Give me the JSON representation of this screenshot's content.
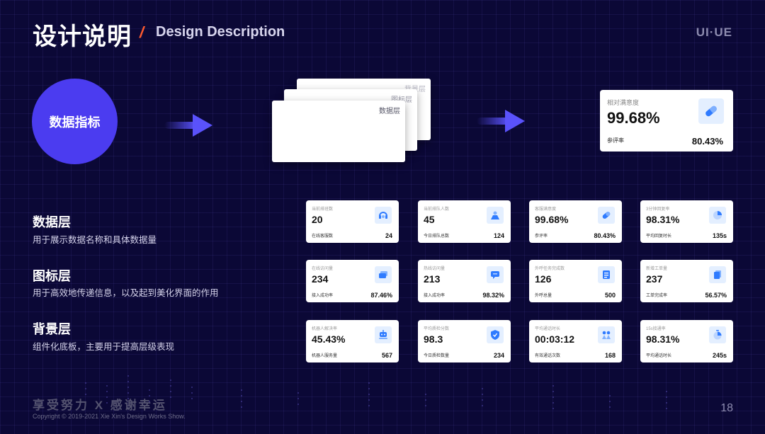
{
  "header": {
    "title_cn": "设计说明",
    "slash": "/",
    "title_en": "Design Description",
    "brand": "UI·UE"
  },
  "hero": {
    "circle_label": "数据指标",
    "layers": [
      "背景层",
      "图标层",
      "数据层"
    ]
  },
  "big_card": {
    "label": "相对满意度",
    "value": "99.68%",
    "foot_label": "参评率",
    "foot_value": "80.43%",
    "icon": "pill-icon"
  },
  "sections": [
    {
      "title": "数据层",
      "text": "用于展示数据名称和具体数据量"
    },
    {
      "title": "图标层",
      "text": "用于高效地传递信息，以及起到美化界面的作用"
    },
    {
      "title": "背景层",
      "text": "组件化底板，主要用于提高层级表现"
    }
  ],
  "cards": [
    {
      "label": "当前排班数",
      "value": "20",
      "foot_label": "在线客服数",
      "foot_value": "24",
      "icon": "headset-icon"
    },
    {
      "label": "当前排队人数",
      "value": "45",
      "foot_label": "今日排队总数",
      "foot_value": "124",
      "icon": "queue-icon"
    },
    {
      "label": "客服满意度",
      "value": "99.68%",
      "foot_label": "参评率",
      "foot_value": "80.43%",
      "icon": "pill-icon"
    },
    {
      "label": "3分钟回复率",
      "value": "98.31%",
      "foot_label": "平均回复时长",
      "foot_value": "135s",
      "icon": "pie-icon"
    },
    {
      "label": "在线访问量",
      "value": "234",
      "foot_label": "接入成功率",
      "foot_value": "87.46%",
      "icon": "chat-icon"
    },
    {
      "label": "热线访问量",
      "value": "213",
      "foot_label": "接入成功率",
      "foot_value": "98.32%",
      "icon": "message-icon"
    },
    {
      "label": "外呼任务完成数",
      "value": "126",
      "foot_label": "外呼总量",
      "foot_value": "500",
      "icon": "task-list-icon"
    },
    {
      "label": "新增工单量",
      "value": "237",
      "foot_label": "工单完成率",
      "foot_value": "56.57%",
      "icon": "ticket-icon"
    },
    {
      "label": "机器人解决率",
      "value": "45.43%",
      "foot_label": "机器人服务量",
      "foot_value": "567",
      "icon": "robot-icon"
    },
    {
      "label": "平均质检分数",
      "value": "98.3",
      "foot_label": "今日质检数量",
      "foot_value": "234",
      "icon": "shield-icon"
    },
    {
      "label": "平均通话时长",
      "value": "00:03:12",
      "foot_label": "有效通话次数",
      "foot_value": "168",
      "icon": "call-agent-icon"
    },
    {
      "label": "15s接通率",
      "value": "98.31%",
      "foot_label": "平均通话时长",
      "foot_value": "245s",
      "icon": "timer-icon"
    }
  ],
  "footer": {
    "slogan": "享受努力 X 感谢幸运",
    "copyright": "Copyright © 2019-2021 Xie Xin's Design Works Show.",
    "page": "18"
  },
  "colors": {
    "background": "#0b0836",
    "accent": "#4b3cf0",
    "arrow": "#5a52fb",
    "slash": "#ff5b2e",
    "icon_blue": "#2f7bff",
    "icon_bg": "#e4efff"
  }
}
